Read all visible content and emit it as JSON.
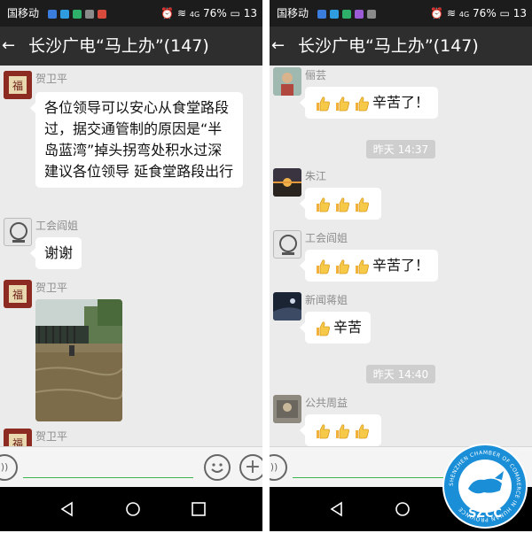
{
  "left": {
    "status": {
      "carrier": "国移动",
      "signal": "4G",
      "battery": "76%",
      "time": "13"
    },
    "title": "长沙广电“马上办”(147)",
    "messages": [
      {
        "sender": "贺卫平",
        "text": "各位领导可以安心从食堂路段过，据交通管制的原因是“半岛蓝湾”掉头拐弯处积水过深  建议各位领导 延食堂路段出行"
      },
      {
        "sender": "工会阎姐",
        "text": "谢谢"
      },
      {
        "sender": "贺卫平",
        "type": "photo"
      },
      {
        "sender": "贺卫平"
      }
    ]
  },
  "right": {
    "status": {
      "carrier": "国移动",
      "signal": "4G",
      "battery": "76%",
      "time": "13"
    },
    "title": "长沙广电“马上办”(147)",
    "messages": [
      {
        "sender": "俪芸",
        "thumbs": 3,
        "text": "辛苦了！"
      },
      {
        "time": "昨天 14:37"
      },
      {
        "sender": "朱江",
        "thumbs": 3,
        "text": ""
      },
      {
        "sender": "工会阎姐",
        "thumbs": 3,
        "text": "辛苦了！"
      },
      {
        "sender": "新闻蒋姐",
        "thumbs": 1,
        "text": "辛苦"
      },
      {
        "time": "昨天 14:40"
      },
      {
        "sender": "公共周益",
        "thumbs": 3,
        "text": ""
      }
    ]
  },
  "watermark": {
    "name": "SZCC",
    "ring_text": "SHENZHEN CHAMBER OF COMMERCE IN HUNAN PROVINCE"
  },
  "colors": {
    "title_bar": "#2e2e2e",
    "chat_bg": "#ebebeb",
    "bubble": "#ffffff",
    "time_divider": "#cecece",
    "accent_green": "#3db650",
    "watermark_blue": "#1a8fd8"
  }
}
